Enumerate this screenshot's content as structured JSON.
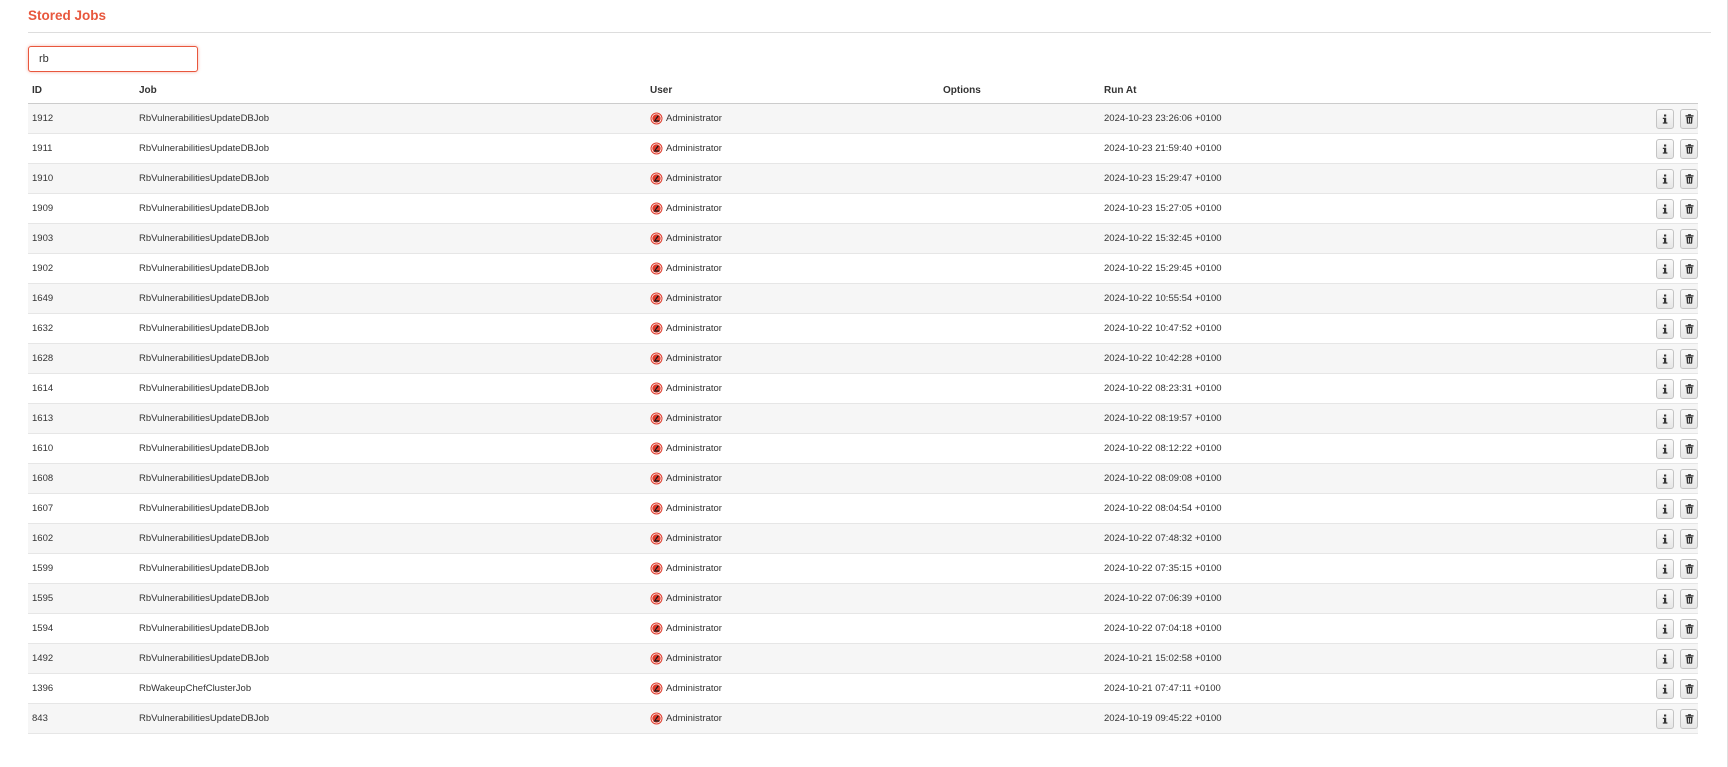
{
  "header": {
    "title": "Stored Jobs"
  },
  "search": {
    "value": "rb",
    "placeholder": ""
  },
  "table": {
    "columns": [
      "ID",
      "Job",
      "User",
      "Options",
      "Run At",
      ""
    ],
    "rows": [
      {
        "id": "1912",
        "job": "RbVulnerabilitiesUpdateDBJob",
        "user": "Administrator",
        "options": "",
        "run_at": "2024-10-23 23:26:06 +0100"
      },
      {
        "id": "1911",
        "job": "RbVulnerabilitiesUpdateDBJob",
        "user": "Administrator",
        "options": "",
        "run_at": "2024-10-23 21:59:40 +0100"
      },
      {
        "id": "1910",
        "job": "RbVulnerabilitiesUpdateDBJob",
        "user": "Administrator",
        "options": "",
        "run_at": "2024-10-23 15:29:47 +0100"
      },
      {
        "id": "1909",
        "job": "RbVulnerabilitiesUpdateDBJob",
        "user": "Administrator",
        "options": "",
        "run_at": "2024-10-23 15:27:05 +0100"
      },
      {
        "id": "1903",
        "job": "RbVulnerabilitiesUpdateDBJob",
        "user": "Administrator",
        "options": "",
        "run_at": "2024-10-22 15:32:45 +0100"
      },
      {
        "id": "1902",
        "job": "RbVulnerabilitiesUpdateDBJob",
        "user": "Administrator",
        "options": "",
        "run_at": "2024-10-22 15:29:45 +0100"
      },
      {
        "id": "1649",
        "job": "RbVulnerabilitiesUpdateDBJob",
        "user": "Administrator",
        "options": "",
        "run_at": "2024-10-22 10:55:54 +0100"
      },
      {
        "id": "1632",
        "job": "RbVulnerabilitiesUpdateDBJob",
        "user": "Administrator",
        "options": "",
        "run_at": "2024-10-22 10:47:52 +0100"
      },
      {
        "id": "1628",
        "job": "RbVulnerabilitiesUpdateDBJob",
        "user": "Administrator",
        "options": "",
        "run_at": "2024-10-22 10:42:28 +0100"
      },
      {
        "id": "1614",
        "job": "RbVulnerabilitiesUpdateDBJob",
        "user": "Administrator",
        "options": "",
        "run_at": "2024-10-22 08:23:31 +0100"
      },
      {
        "id": "1613",
        "job": "RbVulnerabilitiesUpdateDBJob",
        "user": "Administrator",
        "options": "",
        "run_at": "2024-10-22 08:19:57 +0100"
      },
      {
        "id": "1610",
        "job": "RbVulnerabilitiesUpdateDBJob",
        "user": "Administrator",
        "options": "",
        "run_at": "2024-10-22 08:12:22 +0100"
      },
      {
        "id": "1608",
        "job": "RbVulnerabilitiesUpdateDBJob",
        "user": "Administrator",
        "options": "",
        "run_at": "2024-10-22 08:09:08 +0100"
      },
      {
        "id": "1607",
        "job": "RbVulnerabilitiesUpdateDBJob",
        "user": "Administrator",
        "options": "",
        "run_at": "2024-10-22 08:04:54 +0100"
      },
      {
        "id": "1602",
        "job": "RbVulnerabilitiesUpdateDBJob",
        "user": "Administrator",
        "options": "",
        "run_at": "2024-10-22 07:48:32 +0100"
      },
      {
        "id": "1599",
        "job": "RbVulnerabilitiesUpdateDBJob",
        "user": "Administrator",
        "options": "",
        "run_at": "2024-10-22 07:35:15 +0100"
      },
      {
        "id": "1595",
        "job": "RbVulnerabilitiesUpdateDBJob",
        "user": "Administrator",
        "options": "",
        "run_at": "2024-10-22 07:06:39 +0100"
      },
      {
        "id": "1594",
        "job": "RbVulnerabilitiesUpdateDBJob",
        "user": "Administrator",
        "options": "",
        "run_at": "2024-10-22 07:04:18 +0100"
      },
      {
        "id": "1492",
        "job": "RbVulnerabilitiesUpdateDBJob",
        "user": "Administrator",
        "options": "",
        "run_at": "2024-10-21 15:02:58 +0100"
      },
      {
        "id": "1396",
        "job": "RbWakeupChefClusterJob",
        "user": "Administrator",
        "options": "",
        "run_at": "2024-10-21 07:47:11 +0100"
      },
      {
        "id": "843",
        "job": "RbVulnerabilitiesUpdateDBJob",
        "user": "Administrator",
        "options": "",
        "run_at": "2024-10-19 09:45:22 +0100"
      }
    ],
    "row_actions": [
      {
        "name": "info-button",
        "icon": "info-icon"
      },
      {
        "name": "delete-button",
        "icon": "trash-icon"
      }
    ]
  },
  "colors": {
    "accent": "#e8573d",
    "row_stripe": "#f6f6f6",
    "user_icon": "#e03a2a"
  }
}
